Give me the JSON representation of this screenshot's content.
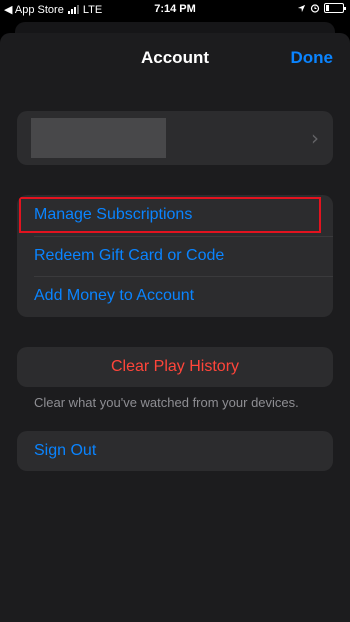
{
  "status_bar": {
    "back_app": "◀ App Store",
    "network": "LTE",
    "time": "7:14 PM"
  },
  "nav": {
    "title": "Account",
    "done_label": "Done"
  },
  "profile": {
    "chevron": "›"
  },
  "links": {
    "manage_subscriptions": "Manage Subscriptions",
    "redeem": "Redeem Gift Card or Code",
    "add_money": "Add Money to Account"
  },
  "history": {
    "clear_label": "Clear Play History",
    "footnote": "Clear what you've watched from your devices."
  },
  "sign_out_label": "Sign Out",
  "colors": {
    "accent": "#0a84ff",
    "destructive": "#ff453a",
    "highlight": "#e2131f",
    "background": "#1c1c1e",
    "cell": "#2c2c2e"
  },
  "icons": [
    "signal-icon",
    "location-icon",
    "alarm-icon",
    "battery-icon",
    "chevron-right-icon"
  ],
  "battery_level": 0.2
}
